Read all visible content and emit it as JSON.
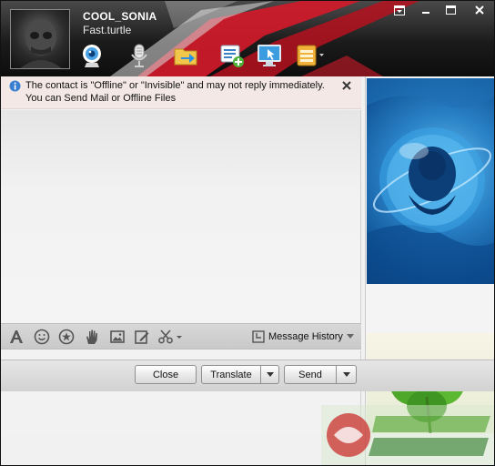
{
  "contact": {
    "nickname": "COOL_SONIA",
    "signature": "Fast.turtle"
  },
  "window_controls": [
    "menu-icon",
    "minimize-icon",
    "maximize-icon",
    "close-icon"
  ],
  "header_tools": [
    "webcam-icon",
    "microphone-icon",
    "file-transfer-icon",
    "message-list-icon",
    "remote-desktop-icon",
    "apps-icon"
  ],
  "notice": {
    "line1": "The contact is \"Offline\" or \"Invisible\" and may not reply immediately.",
    "line2": "You can Send Mail or Offline Files"
  },
  "input_toolbar": {
    "tools": [
      "font-icon",
      "emoticon-icon",
      "magic-emoticon-icon",
      "nudge-icon",
      "image-icon",
      "scribble-icon",
      "screenshot-icon"
    ],
    "history_label": "Message History"
  },
  "buttons": {
    "close": "Close",
    "translate": "Translate",
    "send": "Send"
  },
  "colors": {
    "header_accent": "#d11a2a",
    "notice_bg": "#f3e8e6",
    "ad_blue": "#2a82c7",
    "leaf_green": "#4fa82a"
  }
}
